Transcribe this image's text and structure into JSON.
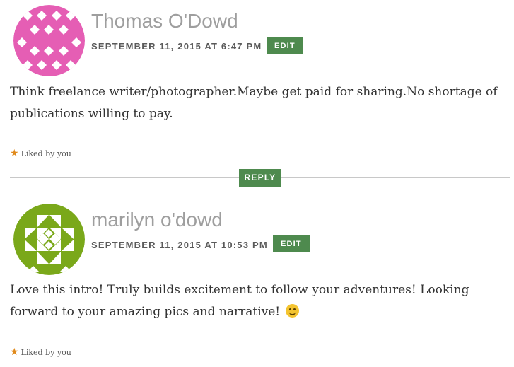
{
  "comments": [
    {
      "author": "Thomas O'Dowd",
      "date": "SEPTEMBER 11, 2015 AT 6:47 PM",
      "edit_label": "EDIT",
      "text": "Think freelance writer/photographer.Maybe get paid for sharing.No shortage of publications willing to pay.",
      "liked": "Liked by you",
      "avatar_color": "#e55eb4"
    },
    {
      "author": "marilyn o'dowd",
      "date": "SEPTEMBER 11, 2015 AT 10:53 PM",
      "edit_label": "EDIT",
      "text": "Love this intro! Truly builds excitement to follow your adventures! Looking forward to your amazing pics and narrative!",
      "liked": "Liked by you",
      "avatar_color": "#7aa81a"
    }
  ],
  "reply_label": "REPLY",
  "colors": {
    "button": "#4e8a4e",
    "star": "#e08a1c",
    "author": "#9e9e9e"
  },
  "icons": {
    "star": "star-icon",
    "smiley": "smiley-emoji-icon"
  }
}
